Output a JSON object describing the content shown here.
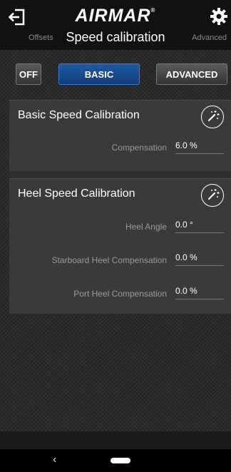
{
  "header": {
    "logo": "AIRMAR",
    "logo_mark": "®",
    "back_icon": "logout-arrow-icon",
    "settings_icon": "gear-icon"
  },
  "subnav": {
    "left": "Offsets",
    "title": "Speed calibration",
    "right": "Advanced"
  },
  "modes": {
    "off": "OFF",
    "basic": "BASIC",
    "advanced": "ADVANCED",
    "selected": "BASIC",
    "selected_color": "#1f5aa6"
  },
  "basic_panel": {
    "title": "Basic Speed Calibration",
    "wand_icon": "magic-wand-icon",
    "rows": [
      {
        "label": "Compensation",
        "value": "6.0 %"
      }
    ]
  },
  "heel_panel": {
    "title": "Heel Speed Calibration",
    "wand_icon": "magic-wand-icon",
    "rows": [
      {
        "label": "Heel Angle",
        "value": "0.0 °"
      },
      {
        "label": "Starboard Heel Compensation",
        "value": "0.0 %"
      },
      {
        "label": "Port Heel Compensation",
        "value": "0.0 %"
      }
    ]
  },
  "system_nav": {
    "back": "‹"
  }
}
